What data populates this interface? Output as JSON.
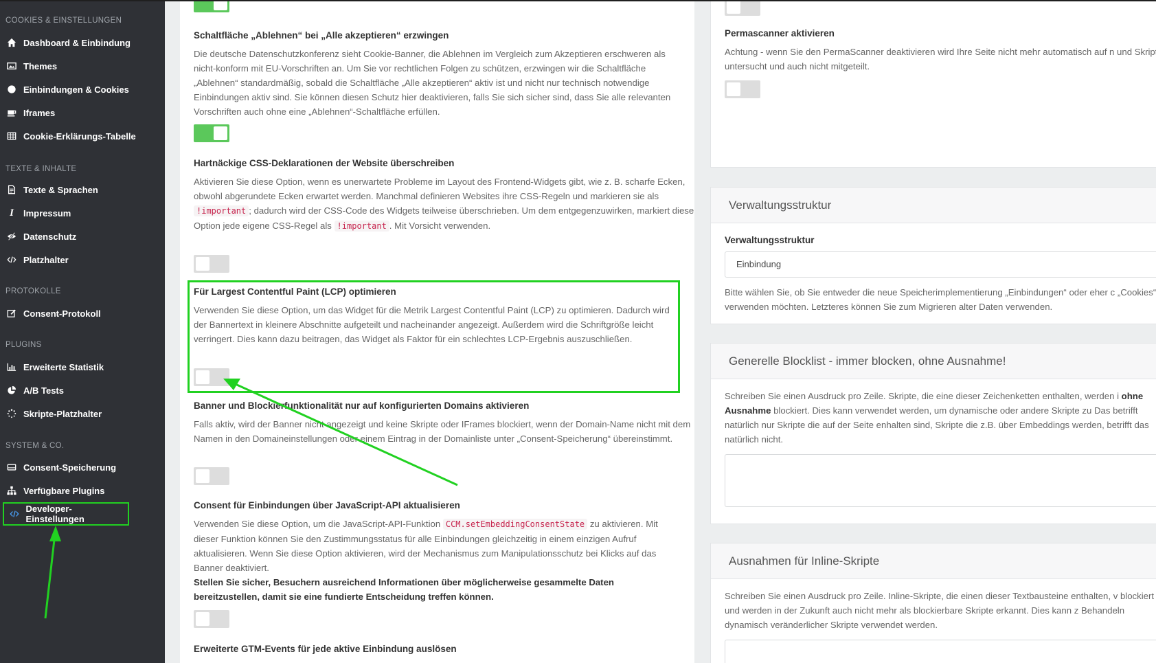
{
  "sidebar": {
    "sections": [
      {
        "title": "Cookies & Einstellungen",
        "items": [
          {
            "label": "Dashboard & Einbindung",
            "icon": "home-icon"
          },
          {
            "label": "Themes",
            "icon": "image-icon"
          },
          {
            "label": "Einbindungen & Cookies",
            "icon": "cookie-icon"
          },
          {
            "label": "Iframes",
            "icon": "coffee-icon"
          },
          {
            "label": "Cookie-Erklärungs-Tabelle",
            "icon": "table-icon"
          }
        ]
      },
      {
        "title": "Texte & Inhalte",
        "items": [
          {
            "label": "Texte & Sprachen",
            "icon": "document-icon"
          },
          {
            "label": "Impressum",
            "icon": "italic-icon"
          },
          {
            "label": "Datenschutz",
            "icon": "eye-slash-icon"
          },
          {
            "label": "Platzhalter",
            "icon": "code-icon"
          }
        ]
      },
      {
        "title": "Protokolle",
        "items": [
          {
            "label": "Consent-Protokoll",
            "icon": "edit-icon"
          }
        ]
      },
      {
        "title": "Plugins",
        "items": [
          {
            "label": "Erweiterte Statistik",
            "icon": "bar-chart-icon"
          },
          {
            "label": "A/B Tests",
            "icon": "pie-chart-icon"
          },
          {
            "label": "Skripte-Platzhalter",
            "icon": "spinner-icon"
          }
        ]
      },
      {
        "title": "System & Co.",
        "items": [
          {
            "label": "Consent-Speicherung",
            "icon": "drive-icon"
          },
          {
            "label": "Verfügbare Plugins",
            "icon": "sitemap-icon"
          },
          {
            "label": "Developer-Einstellungen",
            "icon": "code-icon"
          }
        ]
      }
    ],
    "active_item": "Developer-Einstellungen"
  },
  "options": [
    {
      "title": "Schaltfläche „Ablehnen“ bei „Alle akzeptieren“ erzwingen",
      "desc": "Die deutsche Datenschutzkonferenz sieht Cookie-Banner, die Ablehnen im Vergleich zum Akzeptieren erschweren als nicht-konform mit EU-Vorschriften an. Um Sie vor rechtlichen Folgen zu schützen, erzwingen wir die Schaltfläche „Ablehnen“ standardmäßig, sobald die Schaltfläche „Alle akzeptieren“ aktiv ist und nicht nur technisch notwendige Einbindungen aktiv sind. Sie können diesen Schutz hier deaktivieren, falls Sie sich sicher sind, dass Sie alle relevanten Vorschriften auch ohne eine „Ablehnen“-Schaltfläche erfüllen.",
      "enabled": true
    },
    {
      "title": "Hartnäckige CSS-Deklarationen der Website überschreiben",
      "desc_a": "Aktivieren Sie diese Option, wenn es unerwartete Probleme im Layout des Frontend-Widgets gibt, wie z. B. scharfe Ecken, obwohl abgerundete Ecken erwartet werden. Manchmal definieren Websites ihre CSS-Regeln und markieren sie als",
      "code": "!important",
      "desc_b": "; dadurch wird der CSS-Code des Widgets teilweise überschrieben. Um dem entgegenzuwirken, markiert diese Option jede eigene CSS-Regel als",
      "desc_c": ". Mit Vorsicht verwenden.",
      "enabled": false
    },
    {
      "title": "Für Largest Contentful Paint (LCP) optimieren",
      "desc": "Verwenden Sie diese Option, um das Widget für die Metrik Largest Contentful Paint (LCP) zu optimieren. Dadurch wird der Bannertext in kleinere Abschnitte aufgeteilt und nacheinander angezeigt. Außerdem wird die Schriftgröße leicht verringert. Dies kann dazu beitragen, das Widget als Faktor für ein schlechtes LCP-Ergebnis auszuschließen.",
      "enabled": false
    },
    {
      "title": "Banner und Blockierfunktionalität nur auf konfigurierten Domains aktivieren",
      "desc": "Falls aktiv, wird der Banner nicht angezeigt und keine Skripte oder IFrames blockiert, wenn der Domain-Name nicht mit dem Namen in den Domaineinstellungen oder einem Eintrag in der Domainliste unter „Consent-Speicherung“ übereinstimmt.",
      "enabled": false
    },
    {
      "title": "Consent für Einbindungen über JavaScript-API aktualisieren",
      "desc_a": "Verwenden Sie diese Option, um die JavaScript-API-Funktion",
      "code": "CCM.setEmbeddingConsentState",
      "desc_b": "zu aktivieren. Mit dieser Funktion können Sie den Zustimmungsstatus für alle Einbindungen gleichzeitig in einem einzigen Aufruf aktualisieren. Wenn Sie diese Option aktivieren, wird der Mechanismus zum Manipulationsschutz bei Klicks auf das Banner deaktiviert.",
      "bold": "Stellen Sie sicher, Besuchern ausreichend Informationen über möglicherweise gesammelte Daten bereitzustellen, damit sie eine fundierte Entscheidung treffen können.",
      "enabled": false
    },
    {
      "title": "Erweiterte GTM-Events für jede aktive Einbindung auslösen"
    }
  ],
  "right": {
    "permascanner": {
      "title": "Permascanner aktivieren",
      "desc": "Achtung - wenn Sie den PermaScanner deaktivieren wird Ihre Seite nicht mehr automatisch auf n und Skripte untersucht und auch nicht mitgeteilt.",
      "enabled": false
    },
    "verwaltung": {
      "header": "Verwaltungsstruktur",
      "label": "Verwaltungsstruktur",
      "selected": "Einbindung",
      "desc": "Bitte wählen Sie, ob Sie entweder die neue Speicherimplementierung „Einbindungen“ oder eher c „Cookies“ verwenden möchten. Letzteres können Sie zum Migrieren alter Daten verwenden."
    },
    "blocklist": {
      "header": "Generelle Blocklist - immer blocken, ohne Ausnahme!",
      "desc_a": "Schreiben Sie einen Ausdruck pro Zeile. Skripte, die eine dieser Zeichenketten enthalten, werden i",
      "bold": "ohne Ausnahme",
      "desc_b": "blockiert. Dies kann verwendet werden, um dynamische oder andere Skripte zu Das betrifft natürlich nur Skripte die auf der Seite enhalten sind, Skripte die z.B. über Embeddings werden, betrifft das natürlich nicht."
    },
    "inline": {
      "header": "Ausnahmen für Inline-Skripte",
      "desc": "Schreiben Sie einen Ausdruck pro Zeile. Inline-Skripte, die einen dieser Textbausteine enthalten, v blockiert und werden in der Zukunft auch nicht mehr als blockierbare Skripte erkannt. Dies kann z Behandeln dynamisch veränderlicher Skripte verwendet werden."
    }
  },
  "colors": {
    "sidebar_bg": "#2f3136",
    "toggle_on": "#5bc85b",
    "toggle_off": "#dddddd",
    "highlight": "#21d121",
    "code": "#c7254e"
  }
}
